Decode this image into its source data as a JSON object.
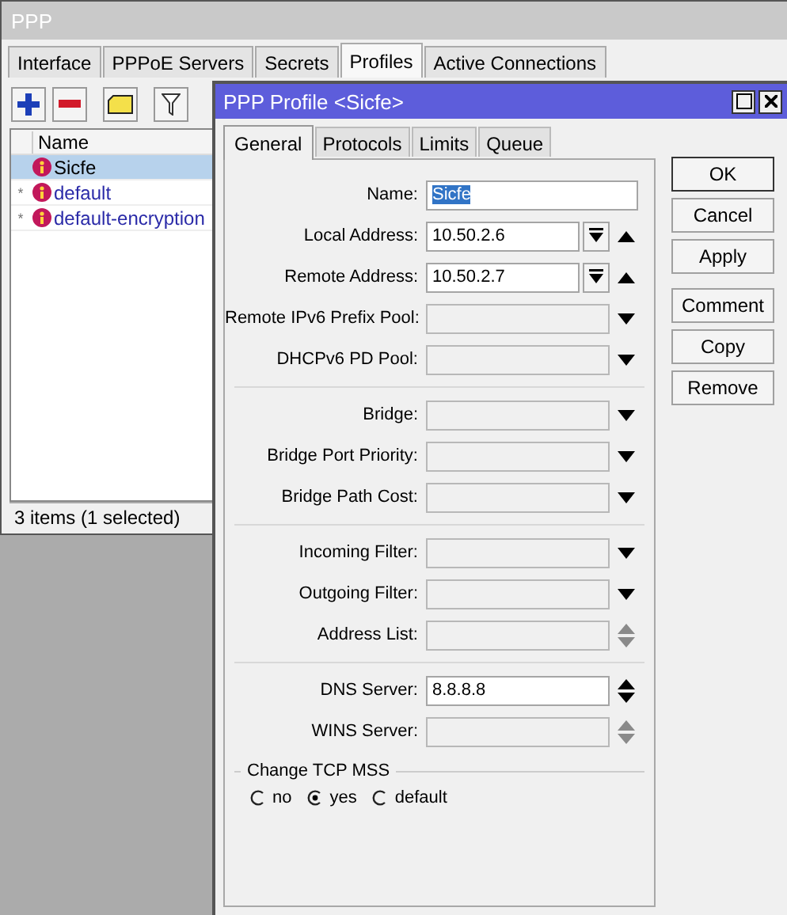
{
  "main_window": {
    "title": "PPP"
  },
  "tabs": [
    {
      "label": "Interface",
      "selected": false
    },
    {
      "label": "PPPoE Servers",
      "selected": false
    },
    {
      "label": "Secrets",
      "selected": false
    },
    {
      "label": "Profiles",
      "selected": true
    },
    {
      "label": "Active Connections",
      "selected": false
    }
  ],
  "table": {
    "columns": [
      "Name"
    ],
    "rows": [
      {
        "flag": "",
        "name": "Sicfe",
        "builtin": false,
        "selected": true
      },
      {
        "flag": "*",
        "name": "default",
        "builtin": true,
        "selected": false
      },
      {
        "flag": "*",
        "name": "default-encryption",
        "builtin": true,
        "selected": false
      }
    ]
  },
  "status_bar": "3 items (1 selected)",
  "dialog": {
    "title": "PPP Profile <Sicfe>",
    "tabs": [
      {
        "label": "General",
        "selected": true
      },
      {
        "label": "Protocols",
        "selected": false
      },
      {
        "label": "Limits",
        "selected": false
      },
      {
        "label": "Queue",
        "selected": false
      }
    ],
    "groups": [
      [
        {
          "label": "Name:",
          "kind": "text",
          "value": "Sicfe",
          "text_selected": true,
          "disabled": false
        },
        {
          "label": "Local Address:",
          "kind": "address",
          "value": "10.50.2.6",
          "disabled": false
        },
        {
          "label": "Remote Address:",
          "kind": "address",
          "value": "10.50.2.7",
          "disabled": false
        },
        {
          "label": "Remote IPv6 Prefix Pool:",
          "kind": "dropdown",
          "disabled": true
        },
        {
          "label": "DHCPv6 PD Pool:",
          "kind": "dropdown",
          "disabled": true
        }
      ],
      [
        {
          "label": "Bridge:",
          "kind": "dropdown",
          "disabled": true
        },
        {
          "label": "Bridge Port Priority:",
          "kind": "dropdown",
          "disabled": true
        },
        {
          "label": "Bridge Path Cost:",
          "kind": "dropdown",
          "disabled": true
        }
      ],
      [
        {
          "label": "Incoming Filter:",
          "kind": "dropdown",
          "disabled": true
        },
        {
          "label": "Outgoing Filter:",
          "kind": "dropdown",
          "disabled": true
        },
        {
          "label": "Address List:",
          "kind": "spinner",
          "disabled": true
        }
      ],
      [
        {
          "label": "DNS Server:",
          "kind": "spinner",
          "value": "8.8.8.8",
          "disabled": false
        },
        {
          "label": "WINS Server:",
          "kind": "spinner",
          "disabled": true
        }
      ]
    ],
    "change_tcp_mss": {
      "title": "Change TCP MSS",
      "options": [
        {
          "label": "no",
          "selected": false
        },
        {
          "label": "yes",
          "selected": true
        },
        {
          "label": "default",
          "selected": false
        }
      ]
    },
    "buttons": [
      {
        "label": "OK",
        "default": true
      },
      {
        "label": "Cancel",
        "default": false
      },
      {
        "label": "Apply",
        "default": false
      },
      {
        "label": "Comment",
        "default": false,
        "gap_before": true
      },
      {
        "label": "Copy",
        "default": false
      },
      {
        "label": "Remove",
        "default": false
      }
    ]
  }
}
